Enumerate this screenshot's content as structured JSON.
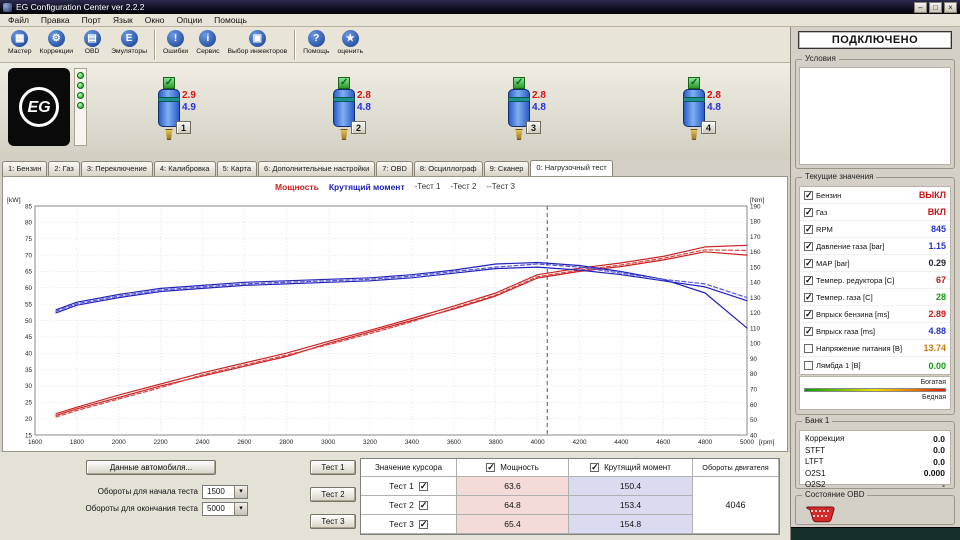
{
  "window": {
    "title": "EG Configuration Center ver 2.2.2",
    "connection_status": "ПОДКЛЮЧЕНО"
  },
  "menu": {
    "items": [
      "Файл",
      "Правка",
      "Порт",
      "Язык",
      "Окно",
      "Опции",
      "Помощь"
    ]
  },
  "toolbar": {
    "buttons": [
      {
        "name": "wizard-icon",
        "glyph": "▦",
        "label": "Мастер"
      },
      {
        "name": "corrections-icon",
        "glyph": "⚙",
        "label": "Коррекции"
      },
      {
        "name": "obd-icon",
        "glyph": "▤",
        "label": "OBD"
      },
      {
        "name": "emulators-icon",
        "glyph": "E",
        "label": "Эмуляторы"
      },
      {
        "name": "errors-icon",
        "glyph": "!",
        "label": "Ошибки"
      },
      {
        "name": "service-icon",
        "glyph": "i",
        "label": "Сервис"
      },
      {
        "name": "injector-select-icon",
        "glyph": "▣",
        "label": "Выбор инжекторов"
      },
      {
        "name": "help-icon",
        "glyph": "?",
        "label": "Помощь"
      },
      {
        "name": "rate-icon",
        "glyph": "★",
        "label": "оценить"
      }
    ]
  },
  "injector_panel": {
    "logo_text": "EG",
    "injectors": [
      {
        "number": "1",
        "petrol_ms": "2.9",
        "gas_ms": "4.9"
      },
      {
        "number": "2",
        "petrol_ms": "2.8",
        "gas_ms": "4.8"
      },
      {
        "number": "3",
        "petrol_ms": "2.8",
        "gas_ms": "4.8"
      },
      {
        "number": "4",
        "petrol_ms": "2.8",
        "gas_ms": "4.8"
      }
    ]
  },
  "tabs": [
    {
      "label": "1: Бензин"
    },
    {
      "label": "2: Газ"
    },
    {
      "label": "3: Переключение"
    },
    {
      "label": "4: Калибровка"
    },
    {
      "label": "5: Карта"
    },
    {
      "label": "6: Дополнительные настройки"
    },
    {
      "label": "7: OBD"
    },
    {
      "label": "8: Осциллограф"
    },
    {
      "label": "9: Сканер"
    },
    {
      "label": "0: Нагрузочный тест",
      "active": true
    }
  ],
  "legend": {
    "power": "Мощность",
    "torque": "Крутящий момент",
    "t1": "-Тест 1",
    "t2": "-Тест 2",
    "t3": "--Тест 3"
  },
  "chart_data": {
    "type": "line",
    "left_axis_label": "[kW]",
    "right_axis_label": "[Nm]",
    "x_axis_label": "[rpm]",
    "x_range": [
      1600,
      5000
    ],
    "x_tick_step": 200,
    "kw_range": [
      15,
      85
    ],
    "kw_tick_step": 5,
    "nm_range": [
      40,
      190
    ],
    "nm_tick_step": 10,
    "grid": true,
    "cursor_rpm": 4046,
    "x": [
      1700,
      1800,
      2000,
      2200,
      2400,
      2600,
      2800,
      3000,
      3200,
      3400,
      3600,
      3800,
      4000,
      4200,
      4400,
      4600,
      4800,
      5000
    ],
    "series": [
      {
        "name": "Мощность Тест 1",
        "unit": "kW",
        "color": "#cc2222",
        "dash": "",
        "values": [
          21,
          23,
          26.5,
          30,
          33,
          36,
          39,
          43,
          46.5,
          50,
          53.5,
          57.5,
          63,
          65,
          66.5,
          68.5,
          71,
          70
        ]
      },
      {
        "name": "Мощность Тест 2",
        "unit": "kW",
        "color": "#cc2222",
        "dash": "",
        "values": [
          21.5,
          23.5,
          27.2,
          30.6,
          34,
          37,
          40,
          43.6,
          47,
          50.6,
          54.4,
          58.4,
          64,
          66,
          67.6,
          69.6,
          72.5,
          73
        ]
      },
      {
        "name": "Мощность Тест 3",
        "unit": "kW",
        "color": "#dd4444",
        "dash": "4,2.5",
        "values": [
          20.5,
          22.5,
          26,
          29.5,
          33.4,
          36.4,
          39.4,
          42.6,
          46,
          49.6,
          53.8,
          57.8,
          63.4,
          65.4,
          67,
          69,
          71.6,
          71.4
        ]
      },
      {
        "name": "Крутящий момент Тест 1",
        "unit": "Nm",
        "color": "#2222bb",
        "dash": "",
        "values": [
          120,
          125,
          130,
          134,
          136,
          138,
          139,
          140,
          141,
          143,
          146,
          149,
          150,
          148,
          145,
          141,
          137,
          128
        ]
      },
      {
        "name": "Крутящий момент Тест 2",
        "unit": "Nm",
        "color": "#2222bb",
        "dash": "",
        "values": [
          122,
          127,
          132,
          136,
          138,
          140,
          141,
          142,
          143,
          145,
          148,
          152,
          153,
          151,
          147,
          142,
          133,
          110
        ]
      },
      {
        "name": "Крутящий момент Тест 3",
        "unit": "Nm",
        "color": "#5555dd",
        "dash": "4,2.5",
        "values": [
          121,
          126,
          131,
          135,
          137,
          139,
          140,
          141,
          142,
          144,
          147,
          150,
          152,
          150,
          146,
          142,
          139,
          130
        ]
      }
    ]
  },
  "controls": {
    "car_data_button": "Данные автомобиля...",
    "start_rpm_label": "Обороты для начала теста",
    "start_rpm_value": "1500",
    "end_rpm_label": "Обороты для окончания теста",
    "end_rpm_value": "5000",
    "test_buttons": [
      "Тест 1",
      "Тест 2",
      "Тест 3"
    ]
  },
  "results_table": {
    "cursor_header": "Значение курсора",
    "power_header": "Мощность",
    "torque_header": "Крутящий момент",
    "rpm_header": "Обороты двигателя",
    "rows": [
      {
        "label": "Тест 1",
        "power": "63.6",
        "torque": "150.4",
        "checked": true
      },
      {
        "label": "Тест 2",
        "power": "64.8",
        "torque": "153.4",
        "checked": true
      },
      {
        "label": "Тест 3",
        "power": "65.4",
        "torque": "154.8",
        "checked": true
      }
    ],
    "engine_rpm": "4046"
  },
  "sidebar": {
    "conditions_label": "Условия",
    "current_values_label": "Текущие значения",
    "rows": [
      {
        "label": "Бензин",
        "value": "ВЫКЛ",
        "checked": true,
        "color": "#cc1111"
      },
      {
        "label": "Газ",
        "value": "ВКЛ",
        "checked": true,
        "color": "#cc1111"
      },
      {
        "label": "RPM",
        "value": "845",
        "checked": true,
        "color": "#2233cc"
      },
      {
        "label": "Давление газа [bar]",
        "value": "1.15",
        "checked": true,
        "color": "#2233cc"
      },
      {
        "label": "MAP [bar]",
        "value": "0.29",
        "checked": true,
        "color": "#222233"
      },
      {
        "label": "Темпер. редуктора [C]",
        "value": "67",
        "checked": true,
        "color": "#cc1111"
      },
      {
        "label": "Темпер. газа [C]",
        "value": "28",
        "checked": true,
        "color": "#119911"
      },
      {
        "label": "Впрыск бензина [ms]",
        "value": "2.89",
        "checked": true,
        "color": "#cc1111"
      },
      {
        "label": "Впрыск газа [ms]",
        "value": "4.88",
        "checked": true,
        "color": "#2233cc"
      },
      {
        "label": "Напряжение питания [B]",
        "value": "13.74",
        "checked": false,
        "color": "#cc7711"
      },
      {
        "label": "Лямбда 1 [B]",
        "value": "0.00",
        "checked": false,
        "color": "#119911"
      }
    ],
    "lambda_rich": "Богатая",
    "lambda_lean": "Бедная",
    "bank_label": "Банк 1",
    "bank_rows": [
      {
        "label": "Коррекция",
        "value": "0.0"
      },
      {
        "label": "STFT",
        "value": "0.0"
      },
      {
        "label": "LTFT",
        "value": "0.0"
      },
      {
        "label": "O2S1",
        "value": "0.000"
      },
      {
        "label": "O2S2",
        "value": "-"
      }
    ],
    "obd_label": "Состояние OBD"
  },
  "colors": {
    "power_line": "#cc2222",
    "torque_line": "#2222bb",
    "value_red": "#cc1111",
    "value_blue": "#2233cc",
    "value_green": "#119911",
    "value_orange": "#cc7711"
  }
}
